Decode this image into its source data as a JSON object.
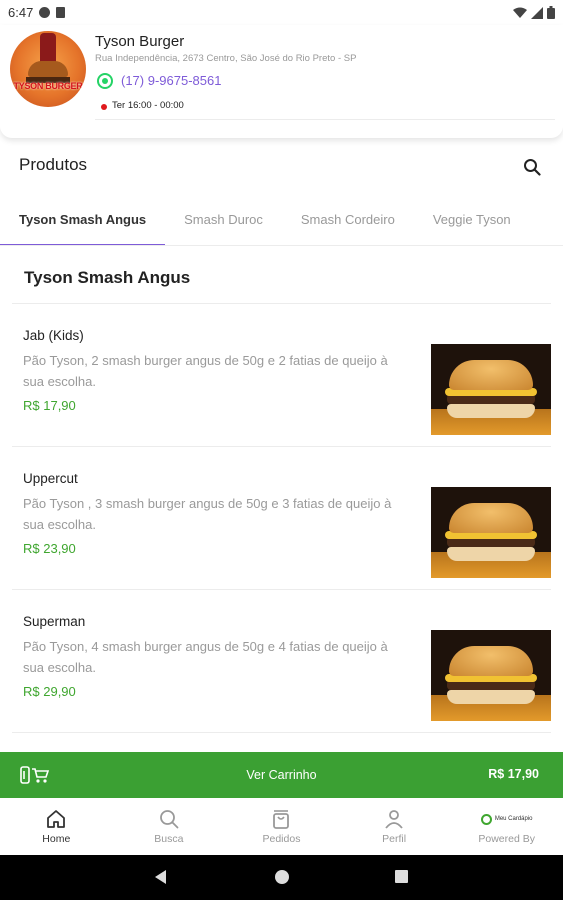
{
  "status_bar": {
    "time": "6:47"
  },
  "store": {
    "logo_text": "TYSON BURGER",
    "name": "Tyson Burger",
    "address": "Rua Independência, 2673 Centro, São José do Rio Preto - SP",
    "phone": "(17) 9-9675-8561",
    "hours": "Ter 16:00 - 00:00",
    "status_color": "#e0191d"
  },
  "section": {
    "title": "Produtos"
  },
  "tabs": [
    {
      "label": "Tyson Smash Angus",
      "active": true
    },
    {
      "label": "Smash Duroc"
    },
    {
      "label": "Smash Cordeiro"
    },
    {
      "label": "Veggie Tyson"
    }
  ],
  "category": {
    "title": "Tyson Smash Angus"
  },
  "products": [
    {
      "name": "Jab (Kids)",
      "description": "Pão Tyson, 2 smash burger angus de 50g e 2 fatias de queijo à sua escolha.",
      "price": "R$ 17,90"
    },
    {
      "name": "Uppercut",
      "description": "Pão Tyson , 3 smash burger angus de 50g e 3 fatias de queijo à sua escolha.",
      "price": "R$ 23,90"
    },
    {
      "name": "Superman",
      "description": "Pão Tyson, 4 smash burger angus de 50g e 4 fatias de queijo à sua escolha.",
      "price": "R$ 29,90"
    }
  ],
  "cart": {
    "label": "Ver Carrinho",
    "total": "R$ 17,90"
  },
  "bottom_nav": {
    "home": "Home",
    "search": "Busca",
    "orders": "Pedidos",
    "profile": "Perfil",
    "powered": "Powered By",
    "powered_logo": "Meu Cardápio"
  },
  "colors": {
    "accent": "#7e5bd8",
    "price": "#3fa62f",
    "cart_bar": "#3ba033"
  }
}
